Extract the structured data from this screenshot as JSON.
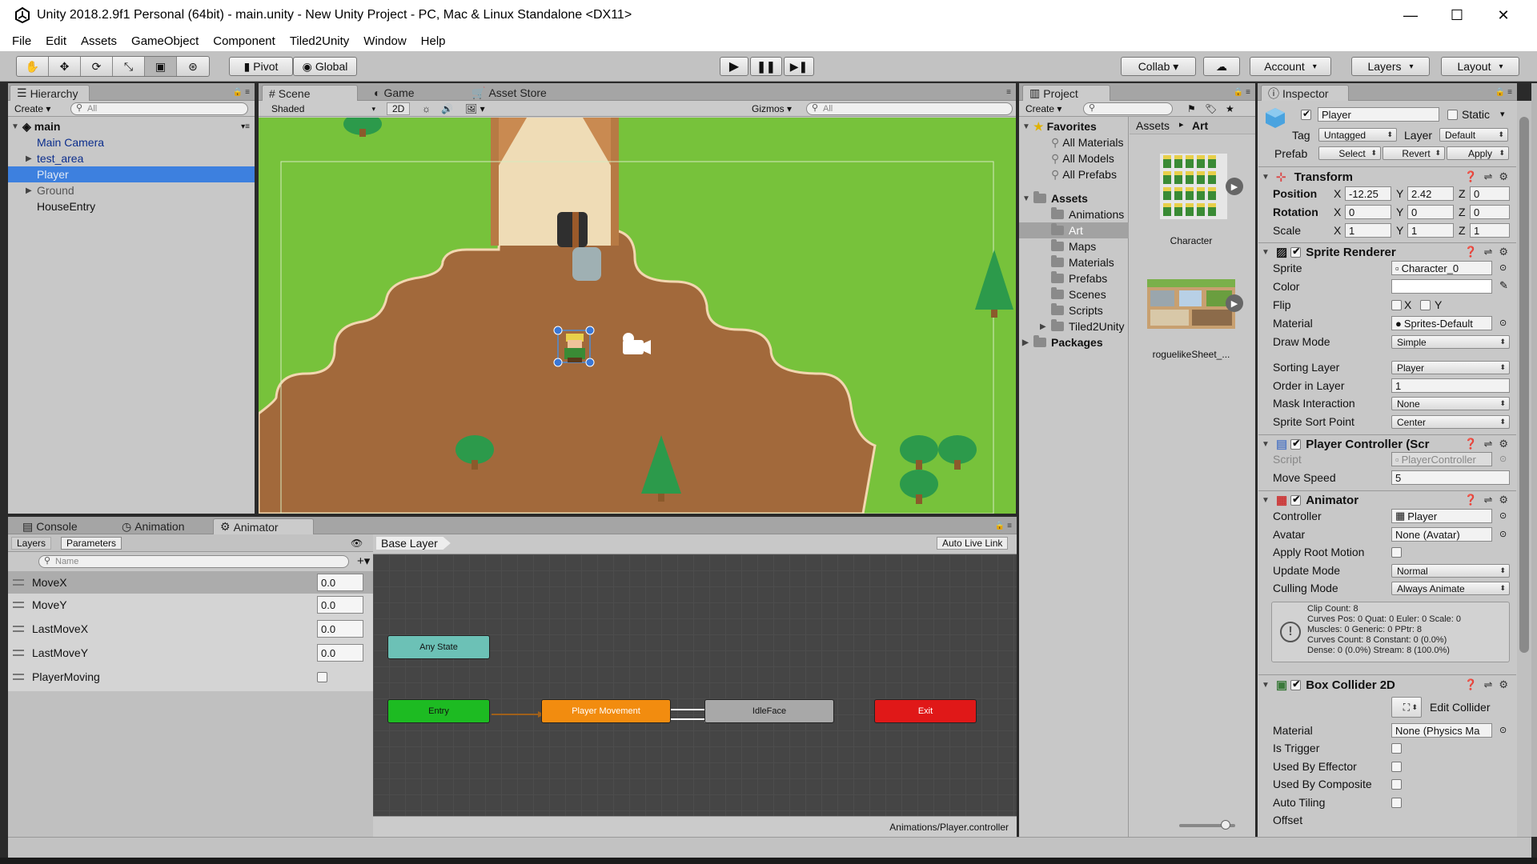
{
  "window": {
    "title": "Unity 2018.2.9f1 Personal (64bit) - main.unity - New Unity Project - PC, Mac & Linux Standalone <DX11>"
  },
  "menu": [
    "File",
    "Edit",
    "Assets",
    "GameObject",
    "Component",
    "Tiled2Unity",
    "Window",
    "Help"
  ],
  "toolbar": {
    "pivot": "Pivot",
    "global": "Global",
    "collab": "Collab ▾",
    "account": "Account",
    "layers": "Layers",
    "layout": "Layout"
  },
  "hierarchy": {
    "tab": "Hierarchy",
    "create": "Create ▾",
    "search": "All",
    "scene": "main",
    "items": [
      "Main Camera",
      "test_area",
      "Player",
      "Ground",
      "HouseEntry"
    ]
  },
  "scene_tabs": {
    "scene": "Scene",
    "game": "Game",
    "store": "Asset Store",
    "shaded": "Shaded",
    "mode2d": "2D",
    "gizmos": "Gizmos ▾",
    "search": "All"
  },
  "bottom_tabs": {
    "console": "Console",
    "animation": "Animation",
    "animator": "Animator"
  },
  "animator": {
    "layers_tab": "Layers",
    "params_tab": "Parameters",
    "name_search": "Name",
    "breadcrumb": "Base Layer",
    "live_link": "Auto Live Link",
    "params": [
      {
        "name": "MoveX",
        "value": "0.0"
      },
      {
        "name": "MoveY",
        "value": "0.0"
      },
      {
        "name": "LastMoveX",
        "value": "0.0"
      },
      {
        "name": "LastMoveY",
        "value": "0.0"
      },
      {
        "name": "PlayerMoving",
        "value": ""
      }
    ],
    "states": {
      "any": "Any State",
      "entry": "Entry",
      "move": "Player Movement",
      "idle": "IdleFace",
      "exit": "Exit"
    },
    "path": "Animations/Player.controller"
  },
  "project": {
    "tab": "Project",
    "create": "Create ▾",
    "favorites": "Favorites",
    "fav_items": [
      "All Materials",
      "All Models",
      "All Prefabs"
    ],
    "assets": "Assets",
    "asset_folders": [
      "Animations",
      "Art",
      "Maps",
      "Materials",
      "Prefabs",
      "Scenes",
      "Scripts",
      "Tiled2Unity"
    ],
    "packages": "Packages",
    "breadcrumb_root": "Assets",
    "breadcrumb_sep": "▸",
    "breadcrumb_leaf": "Art",
    "files": [
      "Character",
      "roguelikeSheet_..."
    ]
  },
  "inspector": {
    "tab": "Inspector",
    "name": "Player",
    "static_label": "Static",
    "tag_label": "Tag",
    "tag": "Untagged",
    "layer_label": "Layer",
    "layer": "Default",
    "prefab_label": "Prefab",
    "select": "Select",
    "revert": "Revert",
    "apply": "Apply",
    "transform": {
      "title": "Transform",
      "position_label": "Position",
      "rotation_label": "Rotation",
      "scale_label": "Scale",
      "position": [
        "-12.25",
        "2.42",
        "0"
      ],
      "rotation": [
        "0",
        "0",
        "0"
      ],
      "scale": [
        "1",
        "1",
        "1"
      ]
    },
    "sprite_renderer": {
      "title": "Sprite Renderer",
      "sprite_label": "Sprite",
      "sprite": "Character_0",
      "color_label": "Color",
      "flip_label": "Flip",
      "flip_x": "X",
      "flip_y": "Y",
      "material_label": "Material",
      "material": "Sprites-Default",
      "draw_mode_label": "Draw Mode",
      "draw_mode": "Simple",
      "sorting_layer_label": "Sorting Layer",
      "sorting_layer": "Player",
      "order_label": "Order in Layer",
      "order": "1",
      "mask_label": "Mask Interaction",
      "mask": "None",
      "sort_point_label": "Sprite Sort Point",
      "sort_point": "Center"
    },
    "player_controller": {
      "title": "Player Controller (Scr",
      "script_label": "Script",
      "script": "PlayerController",
      "speed_label": "Move Speed",
      "speed": "5"
    },
    "animator_comp": {
      "title": "Animator",
      "controller_label": "Controller",
      "controller": "Player",
      "avatar_label": "Avatar",
      "avatar": "None (Avatar)",
      "root_motion_label": "Apply Root Motion",
      "update_label": "Update Mode",
      "update": "Normal",
      "culling_label": "Culling Mode",
      "culling": "Always Animate",
      "info": [
        "Clip Count: 8",
        "Curves Pos: 0 Quat: 0 Euler: 0 Scale: 0",
        "Muscles: 0 Generic: 0 PPtr: 8",
        "Curves Count: 8 Constant: 0 (0.0%)",
        "Dense: 0 (0.0%) Stream: 8 (100.0%)"
      ]
    },
    "box_collider": {
      "title": "Box Collider 2D",
      "edit": "Edit Collider",
      "material_label": "Material",
      "material": "None (Physics Ma",
      "trigger_label": "Is Trigger",
      "effector_label": "Used By Effector",
      "composite_label": "Used By Composite",
      "tiling_label": "Auto Tiling",
      "offset_label": "Offset"
    }
  },
  "colors": {
    "selection": "#3d80df",
    "grass": "#77c23b",
    "dirt": "#a2693b",
    "entry": "#1dbb22",
    "exit": "#e01818",
    "move": "#f28c0f",
    "any": "#6cc1b6"
  }
}
